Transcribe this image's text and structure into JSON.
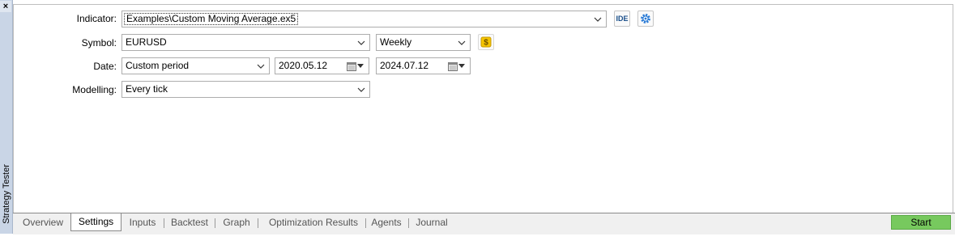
{
  "panel": {
    "title": "Strategy Tester",
    "close_glyph": "×"
  },
  "form": {
    "indicator": {
      "label": "Indicator:",
      "value": "Examples\\Custom Moving Average.ex5"
    },
    "ide_button": "IDE",
    "symbol": {
      "label": "Symbol:",
      "value": "EURUSD"
    },
    "timeframe": {
      "value": "Weekly"
    },
    "date": {
      "label": "Date:",
      "mode": "Custom period",
      "from": "2020.05.12",
      "to": "2024.07.12"
    },
    "modelling": {
      "label": "Modelling:",
      "value": "Every tick"
    }
  },
  "tabs": [
    "Overview",
    "Settings",
    "Inputs",
    "Backtest",
    "Graph",
    "Optimization Results",
    "Agents",
    "Journal"
  ],
  "active_tab": "Settings",
  "start_button": "Start",
  "icons": [
    "close-icon",
    "dropdown-chevron-icon",
    "gear-icon",
    "dollar-icon",
    "calendar-icon"
  ],
  "colors": {
    "start": "#77c95e",
    "dollar": "#f5c400",
    "gear": "#2a7bd6",
    "side_panel": "#c9d5e6"
  }
}
